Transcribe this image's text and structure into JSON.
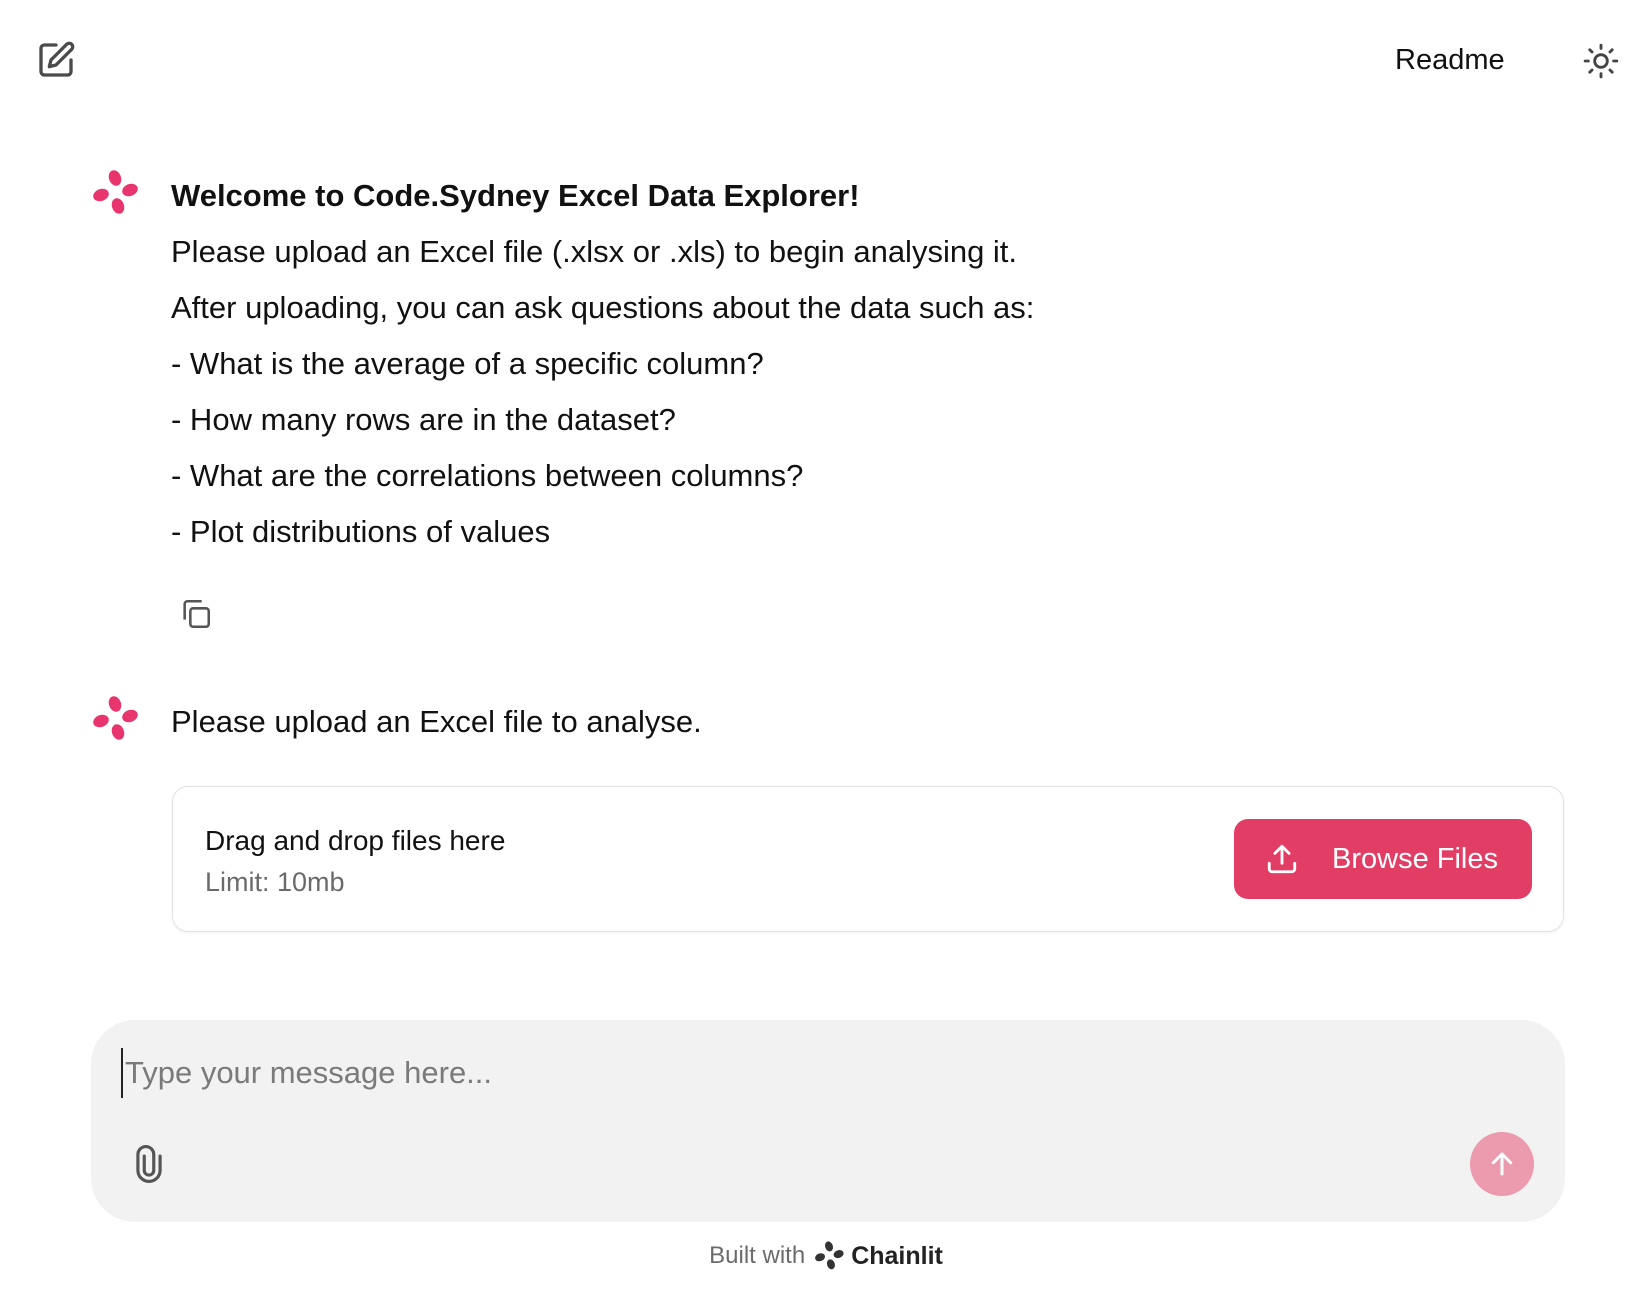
{
  "header": {
    "new_chat_icon": "edit-square-icon",
    "readme_label": "Readme",
    "theme_icon": "sun-icon"
  },
  "messages": [
    {
      "avatar_icon": "chainlit-logo-icon",
      "lines": [
        "Welcome to Code.Sydney Excel Data Explorer!",
        "Please upload an Excel file (.xlsx or .xls) to begin analysing it.",
        "After uploading, you can ask questions about the data such as:",
        "- What is the average of a specific column?",
        "- How many rows are in the dataset?",
        "- What are the correlations between columns?",
        "- Plot distributions of values"
      ],
      "copy_icon": "copy-icon"
    },
    {
      "avatar_icon": "chainlit-logo-icon",
      "lines": [
        "Please upload an Excel file to analyse."
      ]
    }
  ],
  "upload": {
    "title": "Drag and drop files here",
    "limit": "Limit: 10mb",
    "browse_label": "Browse Files",
    "browse_icon": "upload-icon"
  },
  "composer": {
    "placeholder": "Type your message here...",
    "value": "",
    "attach_icon": "paperclip-icon",
    "send_icon": "arrow-up-icon"
  },
  "footer": {
    "built_with": "Built with",
    "brand": "Chainlit"
  },
  "colors": {
    "accent": "#e13d65",
    "send_button": "#ec9aad",
    "logo": "#e8356d",
    "composer_bg": "#f2f2f2"
  }
}
